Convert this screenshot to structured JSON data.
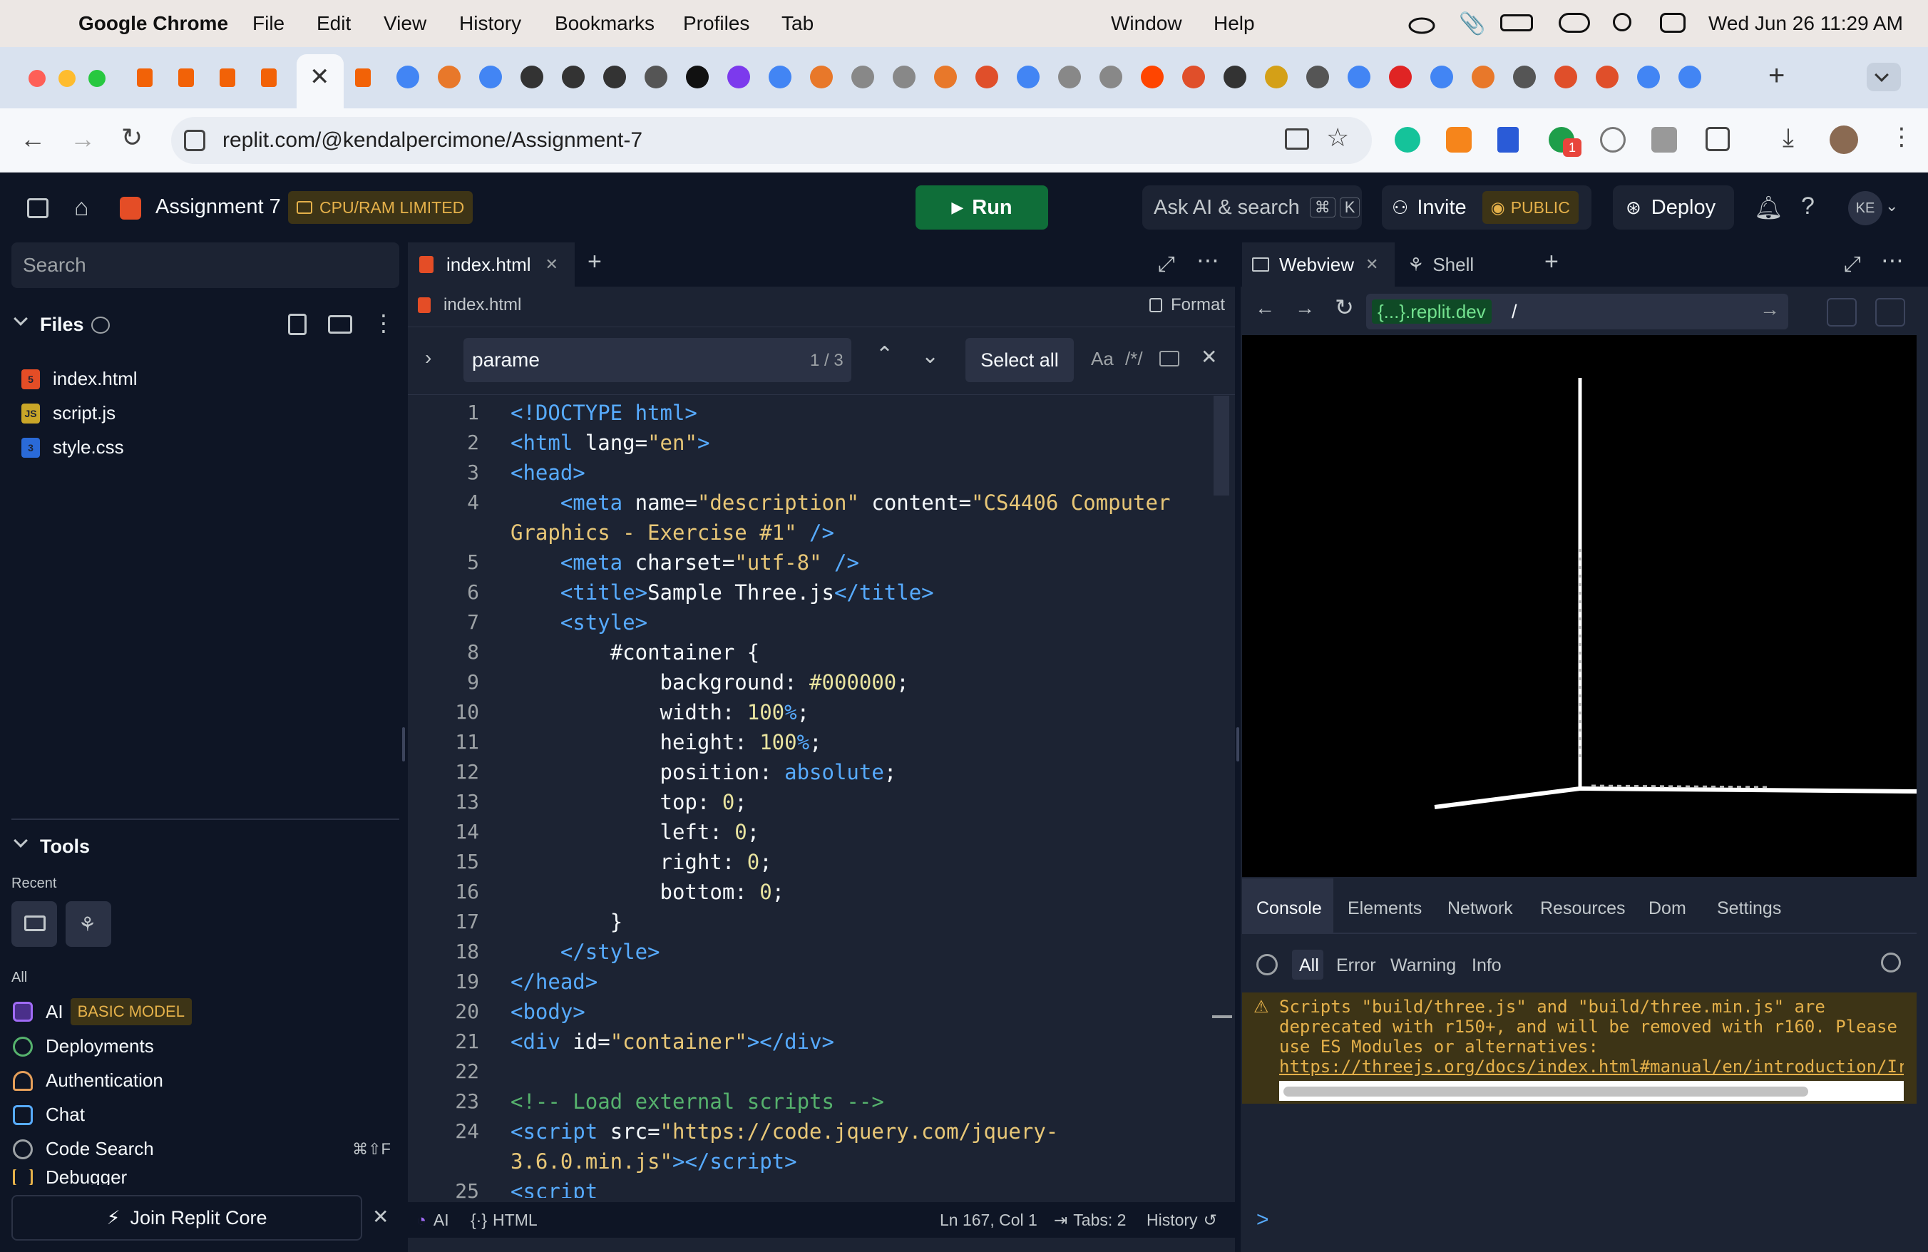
{
  "menubar": {
    "app": "Google Chrome",
    "items": [
      "File",
      "Edit",
      "View",
      "History",
      "Bookmarks",
      "Profiles",
      "Tab",
      "Window",
      "Help"
    ],
    "datetime": "Wed Jun 26  11:29 AM"
  },
  "browser": {
    "url": "replit.com/@kendalpercimone/Assignment-7",
    "new_tab": "+",
    "ext_badge": "1"
  },
  "header": {
    "project_name": "Assignment 7",
    "limit_badge": "CPU/RAM LIMITED",
    "run_label": "Run",
    "search_label": "Ask AI & search",
    "search_kbd1": "⌘",
    "search_kbd2": "K",
    "invite_label": "Invite",
    "public_label": "PUBLIC",
    "deploy_label": "Deploy",
    "avatar_initials": "KE"
  },
  "sidebar": {
    "search_placeholder": "Search",
    "files_title": "Files",
    "files": [
      {
        "name": "index.html",
        "icon_label": "5"
      },
      {
        "name": "script.js",
        "icon_label": "JS"
      },
      {
        "name": "style.css",
        "icon_label": "3"
      }
    ],
    "tools_title": "Tools",
    "recent_label": "Recent",
    "all_label": "All",
    "ai_badge": "BASIC MODEL",
    "tools": [
      {
        "name": "AI"
      },
      {
        "name": "Deployments"
      },
      {
        "name": "Authentication"
      },
      {
        "name": "Chat"
      },
      {
        "name": "Code Search",
        "shortcut": "⌘⇧F"
      },
      {
        "name": "Debugger"
      }
    ],
    "join_label": "Join Replit Core"
  },
  "editor": {
    "tab_label": "index.html",
    "breadcrumb": "index.html",
    "format_label": "Format",
    "find_value": "parame",
    "find_count": "1 / 3",
    "select_all": "Select all",
    "case_opt": "Aa",
    "regex_opt": "/*/",
    "line_numbers": [
      "1",
      "2",
      "3",
      "4",
      "",
      "5",
      "6",
      "7",
      "8",
      "9",
      "10",
      "11",
      "12",
      "13",
      "14",
      "15",
      "16",
      "17",
      "18",
      "19",
      "20",
      "21",
      "22",
      "23",
      "24",
      "",
      "25"
    ],
    "status_ai": "AI",
    "status_lang": "HTML",
    "status_pos": "Ln 167, Col 1",
    "status_tabs": "Tabs: 2",
    "status_history": "History"
  },
  "right_panel": {
    "tab_webview": "Webview",
    "tab_shell": "Shell",
    "url_prefix": "{...}.replit.dev",
    "url_path": "/",
    "devtools_tabs": [
      "Console",
      "Elements",
      "Network",
      "Resources",
      "Dom",
      "Settings"
    ],
    "filters": [
      "All",
      "Error",
      "Warning",
      "Info"
    ],
    "warning_lines": [
      "Scripts \"build/three.js\" and \"build/three.min.js\" are",
      "deprecated with r150+, and will be removed with r160. Please",
      "use ES Modules or alternatives:"
    ],
    "warning_link": "https://threejs.org/docs/index.html#manual/en/introduction/Ir",
    "prompt": ">"
  },
  "colors": {
    "run_green": "#0f6e39",
    "limit_yellow": "#e5b14a",
    "accent_blue": "#0079f2"
  }
}
